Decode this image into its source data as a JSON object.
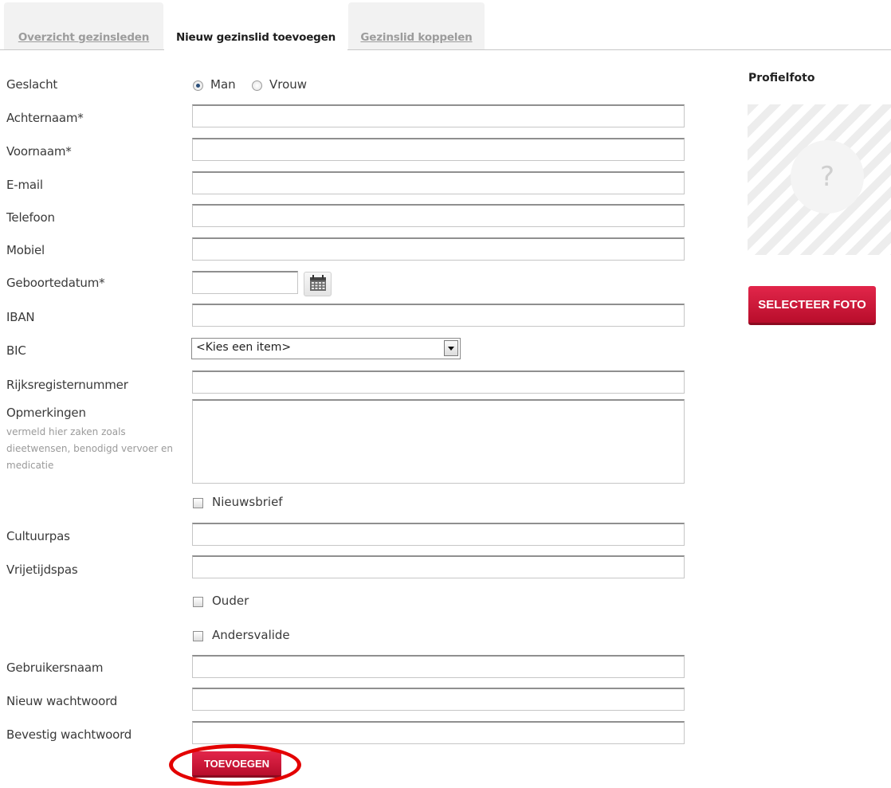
{
  "tabs": [
    {
      "label": "Overzicht gezinsleden",
      "active": false
    },
    {
      "label": "Nieuw gezinslid toevoegen",
      "active": true
    },
    {
      "label": "Gezinslid koppelen",
      "active": false
    }
  ],
  "form": {
    "gender_label": "Geslacht",
    "gender_options": [
      "Man",
      "Vrouw"
    ],
    "gender_selected": "Man",
    "lastname_label": "Achternaam*",
    "firstname_label": "Voornaam*",
    "email_label": "E-mail",
    "phone_label": "Telefoon",
    "mobile_label": "Mobiel",
    "birthdate_label": "Geboortedatum*",
    "iban_label": "IBAN",
    "bic_label": "BIC",
    "bic_value": "<Kies een item>",
    "rrn_label": "Rijksregisternummer",
    "remarks_label": "Opmerkingen",
    "remarks_hint": "vermeld hier zaken zoals dieetwensen, benodigd vervoer en medicatie",
    "newsletter_label": "Nieuwsbrief",
    "cultuurpas_label": "Cultuurpas",
    "vrijetijdspas_label": "Vrijetijdspas",
    "parent_label": "Ouder",
    "disabled_label": "Andersvalide",
    "username_label": "Gebruikersnaam",
    "newpass_label": "Nieuw wachtwoord",
    "confirmpass_label": "Bevestig wachtwoord",
    "submit_label": "TOEVOEGEN"
  },
  "profile": {
    "title": "Profielfoto",
    "placeholder": "?",
    "button_label": "SELECTEER FOTO"
  },
  "icons": {
    "calendar": "calendar-icon"
  },
  "colors": {
    "accent": "#d0163b",
    "highlight_ring": "#e30000"
  }
}
